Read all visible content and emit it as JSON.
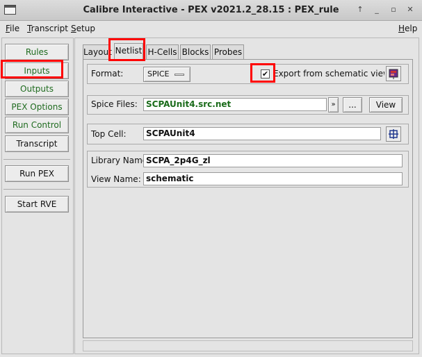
{
  "window": {
    "title": "Calibre Interactive - PEX v2021.2_28.15 : PEX_rule",
    "controls": [
      "↑",
      "_",
      "▫",
      "✕"
    ]
  },
  "menubar": {
    "file": "File",
    "transcript": "Transcript",
    "setup": "Setup",
    "help": "Help"
  },
  "sidebar": {
    "rules": "Rules",
    "inputs": "Inputs",
    "outputs": "Outputs",
    "pex_options": "PEX Options",
    "run_control": "Run Control",
    "transcript": "Transcript",
    "run_pex": "Run PEX",
    "start_rve": "Start RVE"
  },
  "tabs": {
    "layout": "Layout",
    "netlist": "Netlist",
    "hcells": "H-Cells",
    "blocks": "Blocks",
    "probes": "Probes"
  },
  "netlist": {
    "format_label": "Format:",
    "format_value": "SPICE",
    "export_checked": "✔",
    "export_label": "Export from schematic viewer",
    "spice_files_label": "Spice Files:",
    "spice_files_value": "SCPAUnit4.src.net",
    "browse_label": "...",
    "view_label": "View",
    "top_cell_label": "Top Cell:",
    "top_cell_value": "SCPAUnit4",
    "library_name_label": "Library Name:",
    "library_name_value": "SCPA_2p4G_zl",
    "view_name_label": "View Name:",
    "view_name_value": "schematic"
  },
  "colors": {
    "highlight": "#ff0000",
    "active_green": "#1f6b1f"
  }
}
